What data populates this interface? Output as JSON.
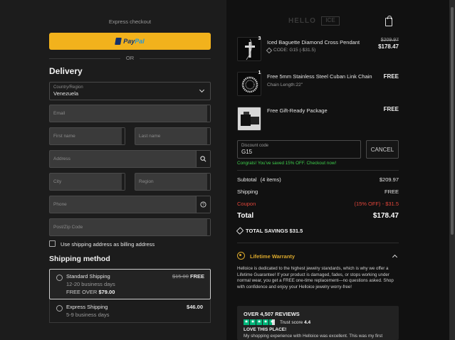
{
  "express_checkout": "Express checkout",
  "paypal": {
    "pay": "Pay",
    "pal": "Pal"
  },
  "or_label": "OR",
  "delivery": {
    "title": "Delivery",
    "country_label": "Country/Region",
    "country_value": "Venezuela",
    "email_placeholder": "Email",
    "first_name_placeholder": "First name",
    "last_name_placeholder": "Last name",
    "address_placeholder": "Address",
    "city_placeholder": "City",
    "region_placeholder": "Region",
    "phone_placeholder": "Phone",
    "postal_placeholder": "Post/Zip Code",
    "billing_checkbox_label": "Use shipping address as billing address"
  },
  "shipping": {
    "title": "Shipping method",
    "options": [
      {
        "name": "Standard Shipping",
        "days": "12-20 business days",
        "old_price": "$15.00",
        "price": "FREE",
        "free_over_prefix": "FREE OVER",
        "free_over_amount": "$79.00"
      },
      {
        "name": "Express Shipping",
        "days": "5-9 business days",
        "price": "$46.00"
      }
    ]
  },
  "brand": {
    "name": "HELLO",
    "badge": "ICE"
  },
  "cart": {
    "items": [
      {
        "qty": "3",
        "name": "Iced Baguette Diamond Cross Pendant",
        "sub": "CODE: G15 (-$31.5)",
        "old_price": "$209.97",
        "price": "$178.47"
      },
      {
        "qty": "1",
        "name": "Free 5mm Stainless Steel Cuban Link Chain",
        "sub": "Chain Length:22\"",
        "price": "FREE"
      },
      {
        "name": "Free Gift-Ready Package",
        "price": "FREE"
      }
    ]
  },
  "discount": {
    "label": "Discount code",
    "value": "G15",
    "cancel": "CANCEL",
    "message": "Congrats! You've saved 15% OFF. Checkout now!"
  },
  "summary": {
    "subtotal_label": "Subtotal",
    "subtotal_items": "(4 items)",
    "subtotal_value": "$209.97",
    "shipping_label": "Shipping",
    "shipping_value": "FREE",
    "coupon_label": "Coupon",
    "coupon_value": "(15% OFF) - $31.5",
    "total_label": "Total",
    "total_value": "$178.47",
    "savings": "TOTAL SAVINGS $31.5"
  },
  "warranty": {
    "title": "Lifetime Warranty",
    "text": "Helloice is dedicated to the highest jewelry standards, which is why we offer a Lifetime Guarantee! If your product is damaged, fades, or stops working under normal wear, you get a FREE one-time replacement—no questions asked. Shop with confidence and enjoy your Helloice jewelry worry-free!"
  },
  "reviews": {
    "heading": "OVER 4,507 REVIEWS",
    "trust_label": "Trust score",
    "trust_score": "4.4",
    "headline": "LOVE THIS PLACE!",
    "text": "My shopping experience with Helloice was excellent. This was my first"
  },
  "colors": {
    "paypal": "#f2b21c",
    "accent_gold": "#d9a72c",
    "success": "#3ecf4c",
    "coupon": "#e0453a",
    "trustpilot": "#00b67a"
  }
}
